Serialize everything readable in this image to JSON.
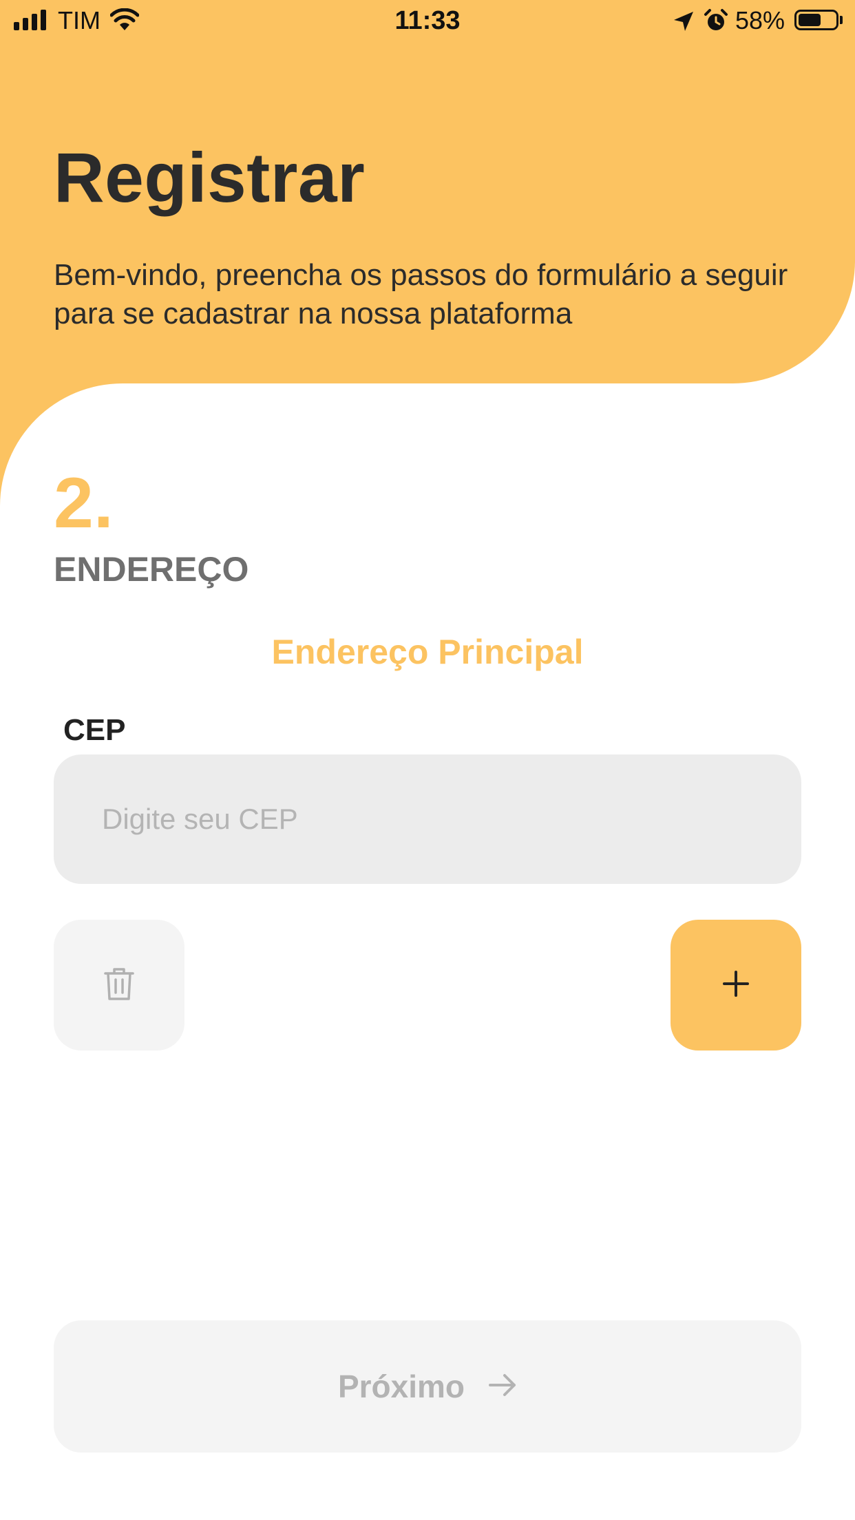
{
  "status_bar": {
    "carrier": "TIM",
    "time": "11:33",
    "battery_percent": "58%",
    "battery_level": 0.58,
    "icons": [
      "signal-icon",
      "wifi-icon",
      "location-arrow-icon",
      "alarm-icon",
      "battery-icon"
    ]
  },
  "header": {
    "title": "Registrar",
    "subtitle": "Bem-vindo, preencha os passos do formulário a seguir para se cadastrar na nossa plataforma"
  },
  "step": {
    "number": "2.",
    "label": "ENDEREÇO"
  },
  "section": {
    "title": "Endereço Principal"
  },
  "cep_field": {
    "label": "CEP",
    "value": "",
    "placeholder": "Digite seu CEP"
  },
  "actions": {
    "delete_icon": "trash-icon",
    "add_icon": "plus-icon",
    "next_label": "Próximo",
    "next_icon": "arrow-right-icon"
  },
  "colors": {
    "accent": "#FCC361",
    "title_text": "#2B2B2B",
    "step_label": "#6F6F6F",
    "input_bg": "#ECECEC",
    "disabled_bg": "#F4F4F4",
    "disabled_text": "#B3B3B3"
  }
}
